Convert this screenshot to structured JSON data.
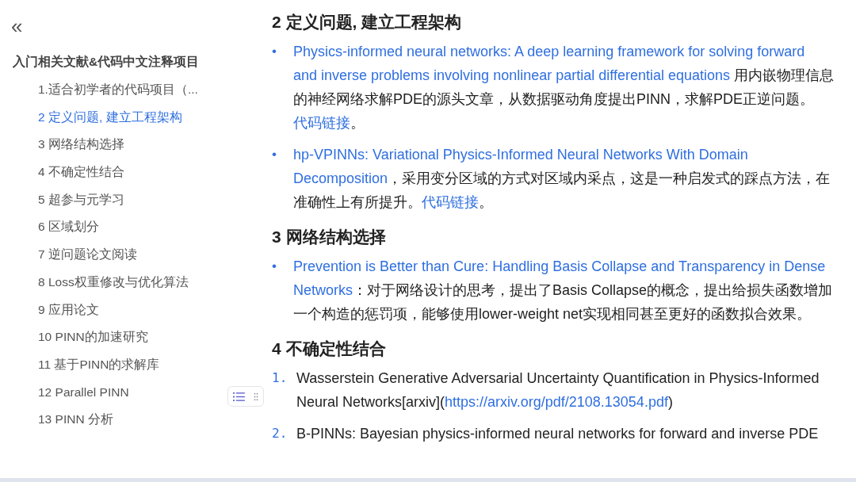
{
  "sidebar": {
    "collapse_icon": "«",
    "title": "入门相关文献&代码中文注释项目",
    "items": [
      {
        "label": "1.适合初学者的代码项目（...",
        "selected": false
      },
      {
        "label": "2 定义问题, 建立工程架构",
        "selected": true
      },
      {
        "label": "3 网络结构选择",
        "selected": false
      },
      {
        "label": "4 不确定性结合",
        "selected": false
      },
      {
        "label": "5 超参与元学习",
        "selected": false
      },
      {
        "label": "6 区域划分",
        "selected": false
      },
      {
        "label": "7 逆问题论文阅读",
        "selected": false
      },
      {
        "label": "8 Loss权重修改与优化算法",
        "selected": false
      },
      {
        "label": "9 应用论文",
        "selected": false
      },
      {
        "label": "10 PINN的加速研究",
        "selected": false
      },
      {
        "label": "11 基于PINN的求解库",
        "selected": false
      },
      {
        "label": "12 Parallel PINN",
        "selected": false
      },
      {
        "label": "13 PINN 分析",
        "selected": false
      }
    ]
  },
  "sections": [
    {
      "heading": "2 定义问题, 建立工程架构",
      "items": [
        {
          "marker": "•",
          "kind": "bullet",
          "segments": [
            {
              "kind": "link",
              "text": "Physics-informed neural networks: A deep learning framework for solving forward"
            },
            {
              "kind": "link",
              "text": "and inverse problems involving nonlinear partial differential equations"
            },
            {
              "kind": "text",
              "text": " 用内嵌物理信息的神经网络求解PDE的源头文章，从数据驱动角度提出PINN，求解PDE正逆问题。"
            },
            {
              "kind": "link",
              "text": "代码链接"
            },
            {
              "kind": "text",
              "text": "。"
            }
          ]
        },
        {
          "marker": "•",
          "kind": "bullet",
          "segments": [
            {
              "kind": "link",
              "text": "hp-VPINNs: Variational Physics-Informed Neural Networks With Domain"
            },
            {
              "kind": "link",
              "text": "Decomposition"
            },
            {
              "kind": "text",
              "text": "，采用变分区域的方式对区域内采点，这是一种启发式的踩点方法，在准确性上有所提升。"
            },
            {
              "kind": "link",
              "text": "代码链接"
            },
            {
              "kind": "text",
              "text": "。"
            }
          ]
        }
      ]
    },
    {
      "heading": "3 网络结构选择",
      "items": [
        {
          "marker": "•",
          "kind": "bullet",
          "segments": [
            {
              "kind": "link",
              "text": "Prevention is Better than Cure: Handling Basis Collapse and Transparency in Dense"
            },
            {
              "kind": "link",
              "text": "Networks"
            },
            {
              "kind": "text",
              "text": "：对于网络设计的思考，提出了Basis Collapse的概念，提出给损失函数增加一个构造的惩罚项，能够使用lower-weight net实现相同甚至更好的函数拟合效果。"
            }
          ]
        }
      ]
    },
    {
      "heading": "4 不确定性结合",
      "items": [
        {
          "marker": "1.",
          "kind": "number",
          "segments": [
            {
              "kind": "text",
              "text": "Wasserstein Generative Adversarial Uncertainty Quantification in Physics-Informed Neural Networks[arxiv]("
            },
            {
              "kind": "link",
              "text": "https://arxiv.org/pdf/2108.13054.pdf"
            },
            {
              "kind": "text",
              "text": ")"
            }
          ]
        },
        {
          "marker": "2.",
          "kind": "number",
          "segments": [
            {
              "kind": "text",
              "text": "B-PINNs: Bayesian physics-informed neural networks for forward and inverse PDE"
            }
          ]
        }
      ]
    }
  ]
}
